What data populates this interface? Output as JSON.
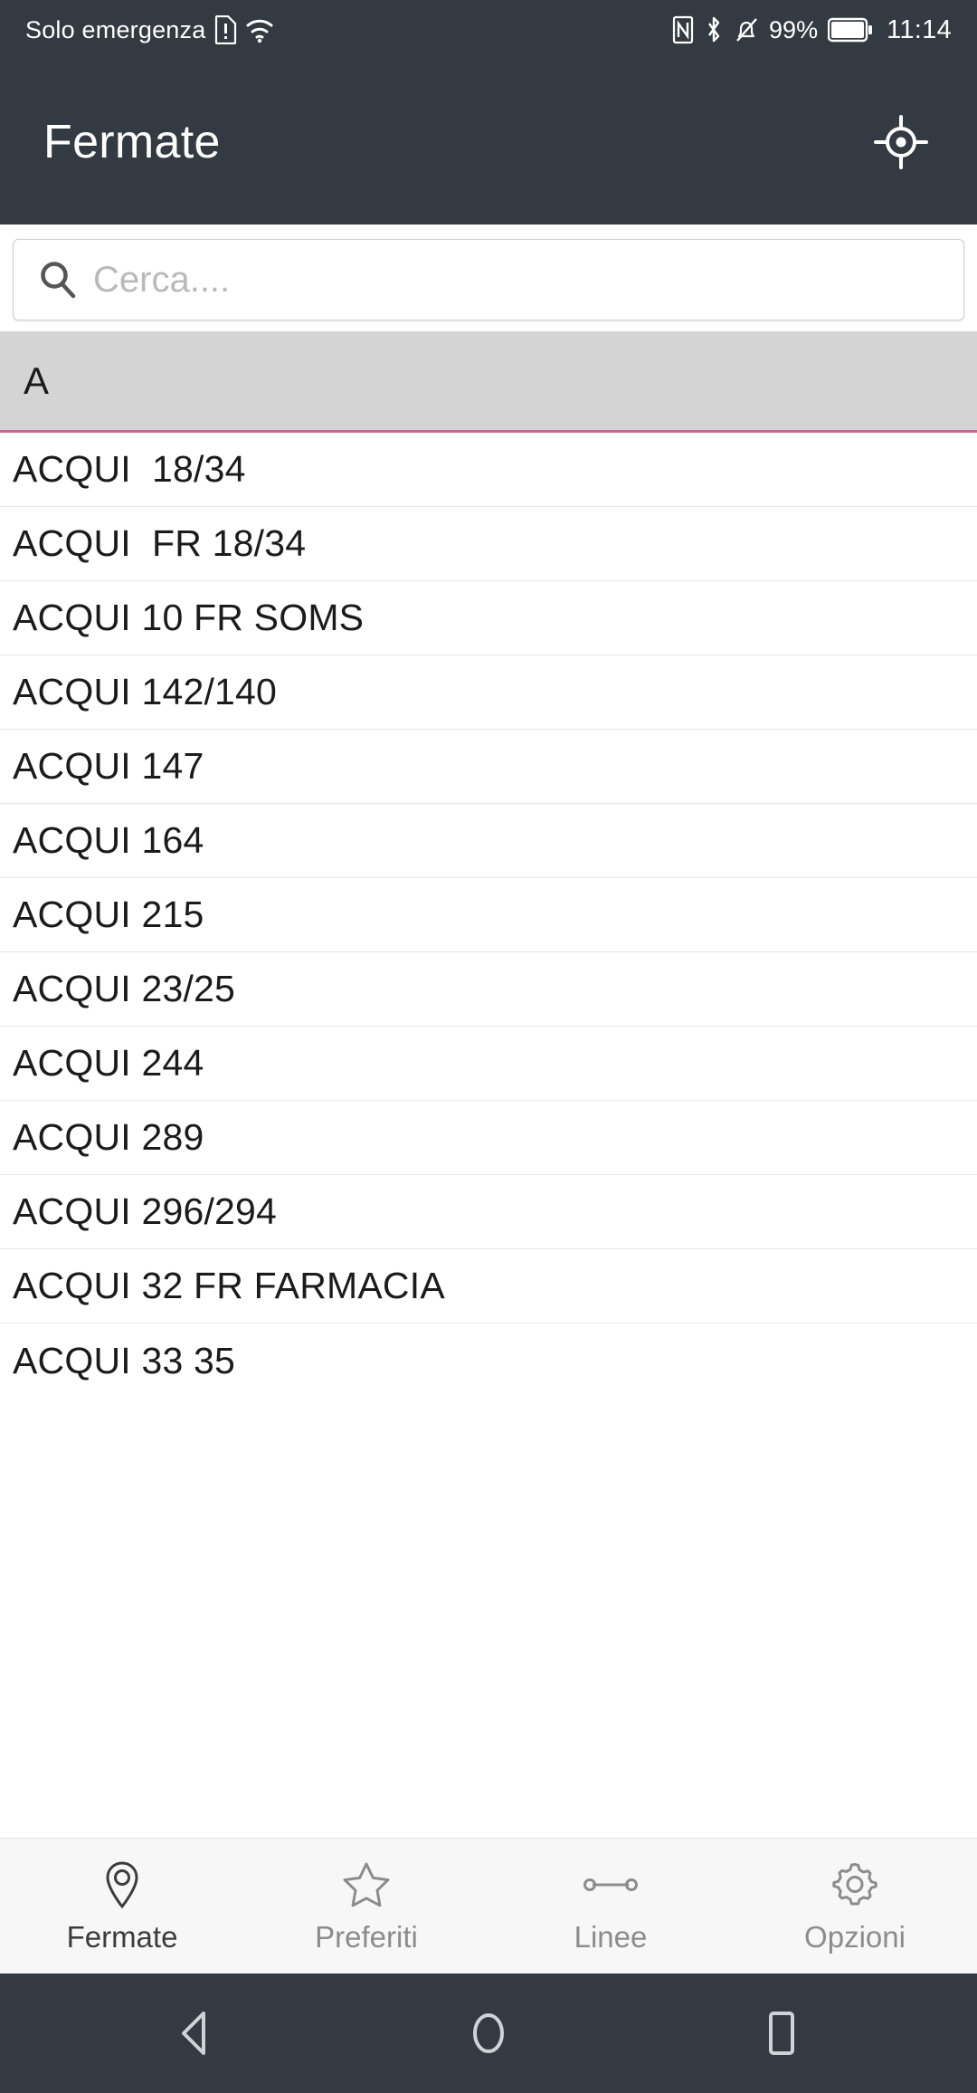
{
  "status_bar": {
    "carrier_text": "Solo emergenza",
    "battery_percent": "99%",
    "clock": "11:14",
    "icons": [
      "sim-alert-icon",
      "wifi-icon",
      "nfc-icon",
      "bluetooth-icon",
      "mute-bell-icon",
      "battery-icon"
    ]
  },
  "app_bar": {
    "title": "Fermate",
    "action_icon": "gps-locate-icon"
  },
  "search": {
    "placeholder": "Cerca....",
    "value": "",
    "icon": "search-icon"
  },
  "list": {
    "section_letter": "A",
    "items": [
      "ACQUI  18/34",
      "ACQUI  FR 18/34",
      "ACQUI 10 FR SOMS",
      "ACQUI 142/140",
      "ACQUI 147",
      "ACQUI 164",
      "ACQUI 215",
      "ACQUI 23/25",
      "ACQUI 244",
      "ACQUI 289",
      "ACQUI 296/294",
      "ACQUI 32 FR FARMACIA",
      "ACQUI 33 35"
    ]
  },
  "bottom_nav": {
    "items": [
      {
        "label": "Fermate",
        "icon": "map-pin-icon",
        "active": true
      },
      {
        "label": "Preferiti",
        "icon": "star-icon",
        "active": false
      },
      {
        "label": "Linee",
        "icon": "route-line-icon",
        "active": false
      },
      {
        "label": "Opzioni",
        "icon": "gear-icon",
        "active": false
      }
    ]
  },
  "android_nav": {
    "back": "back-triangle-icon",
    "home": "home-circle-icon",
    "recents": "recents-square-icon"
  },
  "colors": {
    "chrome": "#343a41",
    "section_header_bg": "#d4d4d4",
    "section_accent": "#cf6391",
    "nav_bg": "#f7f7f7",
    "nav_inactive": "#8c8c8c",
    "nav_active": "#3c3c3c"
  }
}
